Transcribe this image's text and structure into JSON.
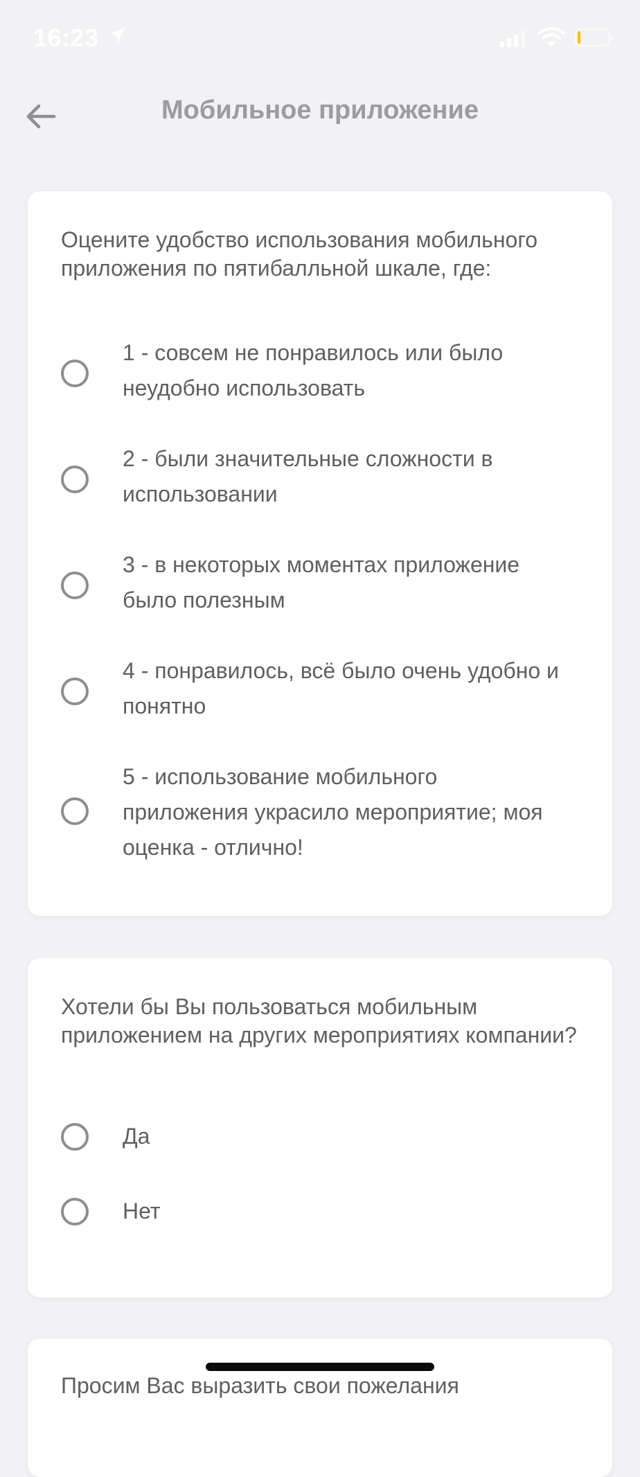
{
  "status_bar": {
    "time": "16:23",
    "icons": [
      "location-icon",
      "signal-icon",
      "wifi-icon",
      "battery-icon"
    ],
    "battery_level_fraction": 0.1,
    "battery_color": "#f5c400"
  },
  "header": {
    "title": "Мобильное приложение",
    "back_icon": "arrow-left-icon"
  },
  "survey": {
    "question1": {
      "text": "Оцените удобство использования мобильного приложения по пятибалльной шкале, где:",
      "options": [
        {
          "label": "1 - совсем не понравилось или было неудобно использовать",
          "selected": false
        },
        {
          "label": "2 - были значительные сложности в использовании",
          "selected": false
        },
        {
          "label": "3 - в некоторых моментах приложение было полезным",
          "selected": false
        },
        {
          "label": "4 - понравилось, всё было очень удобно и понятно",
          "selected": false
        },
        {
          "label": "5 - использование мобильного приложения украсило мероприятие; моя оценка - отлично!",
          "selected": false
        }
      ]
    },
    "question2": {
      "text": "Хотели бы Вы пользоваться мобильным приложением на других мероприятиях компании?",
      "options": [
        {
          "label": "Да",
          "selected": false
        },
        {
          "label": "Нет",
          "selected": false
        }
      ]
    },
    "question3": {
      "text": "Просим Вас выразить свои пожелания"
    }
  },
  "colors": {
    "background": "#f2f2f5",
    "card": "#ffffff",
    "text": "#5f5f5f",
    "title": "#9b9ba0",
    "radio_border": "#8e8e8e"
  }
}
